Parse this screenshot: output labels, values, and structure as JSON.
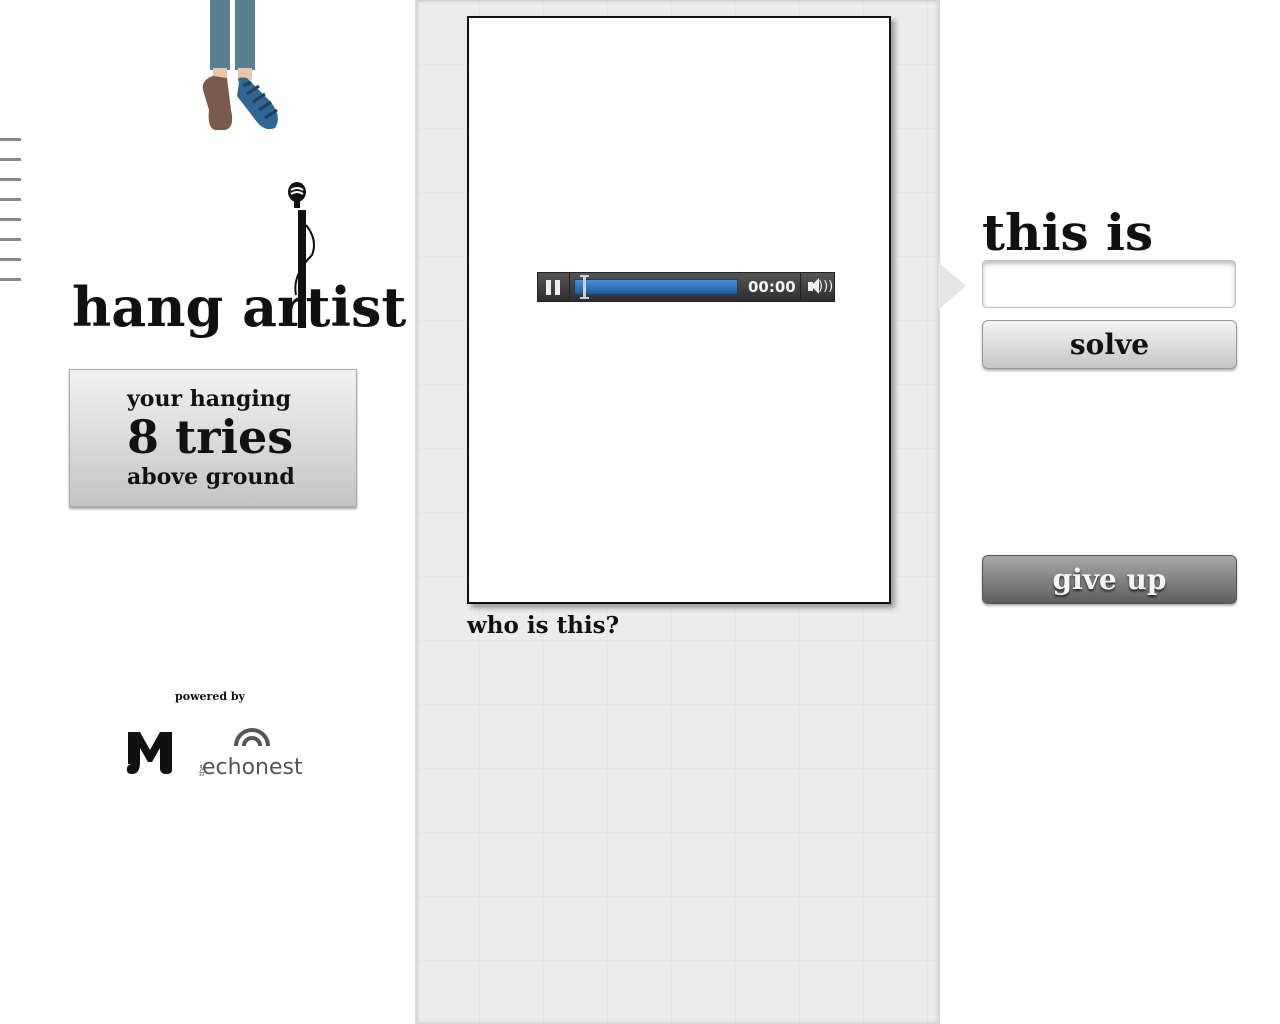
{
  "app": {
    "logo_text": "hang artist"
  },
  "status": {
    "line1": "your hanging",
    "line2": "8 tries",
    "line3": "above ground",
    "tries_remaining": 8
  },
  "footer": {
    "powered_by": "powered by"
  },
  "player": {
    "time": "00:00",
    "progress": 0,
    "state": "playing"
  },
  "prompt": {
    "question": "who is this?"
  },
  "answer": {
    "label": "this is",
    "value": "",
    "placeholder": "",
    "solve_label": "solve",
    "give_up_label": "give up"
  },
  "colors": {
    "track_blue": "#2a6fb8",
    "panel_gray": "#ececec"
  },
  "icons": {
    "pause": "pause-icon",
    "volume": "volume-icon",
    "microphone": "microphone-icon"
  }
}
